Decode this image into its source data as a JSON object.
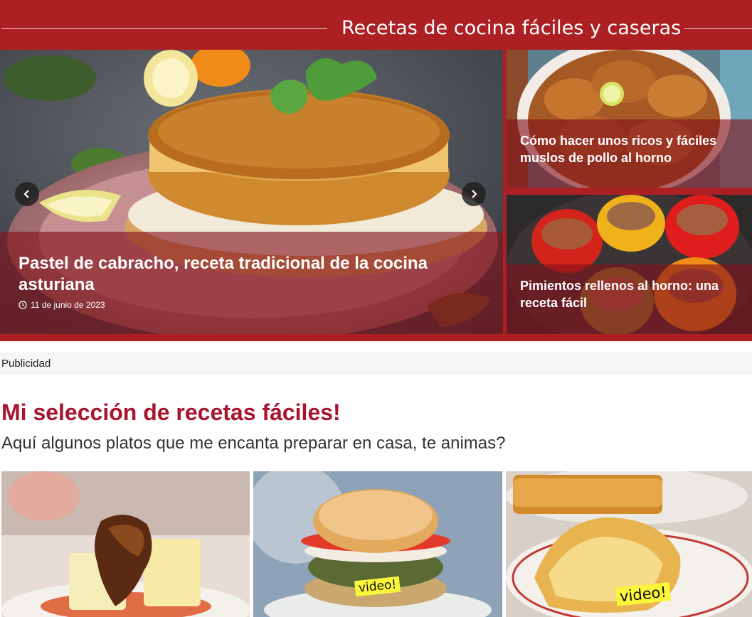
{
  "header": {
    "title": "Recetas de cocina fáciles y caseras"
  },
  "featured": {
    "main": {
      "title": "Pastel de cabracho, receta tradicional de la cocina asturiana",
      "date": "11 de junio de 2023",
      "date_icon": "clock-icon",
      "prev_icon": "chevron-left-icon",
      "next_icon": "chevron-right-icon"
    },
    "side": [
      {
        "title": "Cómo hacer unos ricos y fáciles muslos de pollo al horno"
      },
      {
        "title": "Pimientos rellenos al horno: una receta fácil"
      }
    ]
  },
  "ad": {
    "label": "Publicidad"
  },
  "selection": {
    "title": "Mi selección de recetas fáciles!",
    "subtitle": "Aquí algunos platos que me encanta preparar en casa, te animas?",
    "cards": [
      {
        "tag": ""
      },
      {
        "tag": "video!"
      },
      {
        "tag": "video!"
      }
    ]
  },
  "colors": {
    "brand_red": "#ac2024",
    "heading_red": "#a8152c",
    "overlay": "rgba(130,18,28,0.62)",
    "video_tag": "#fbf63a"
  }
}
